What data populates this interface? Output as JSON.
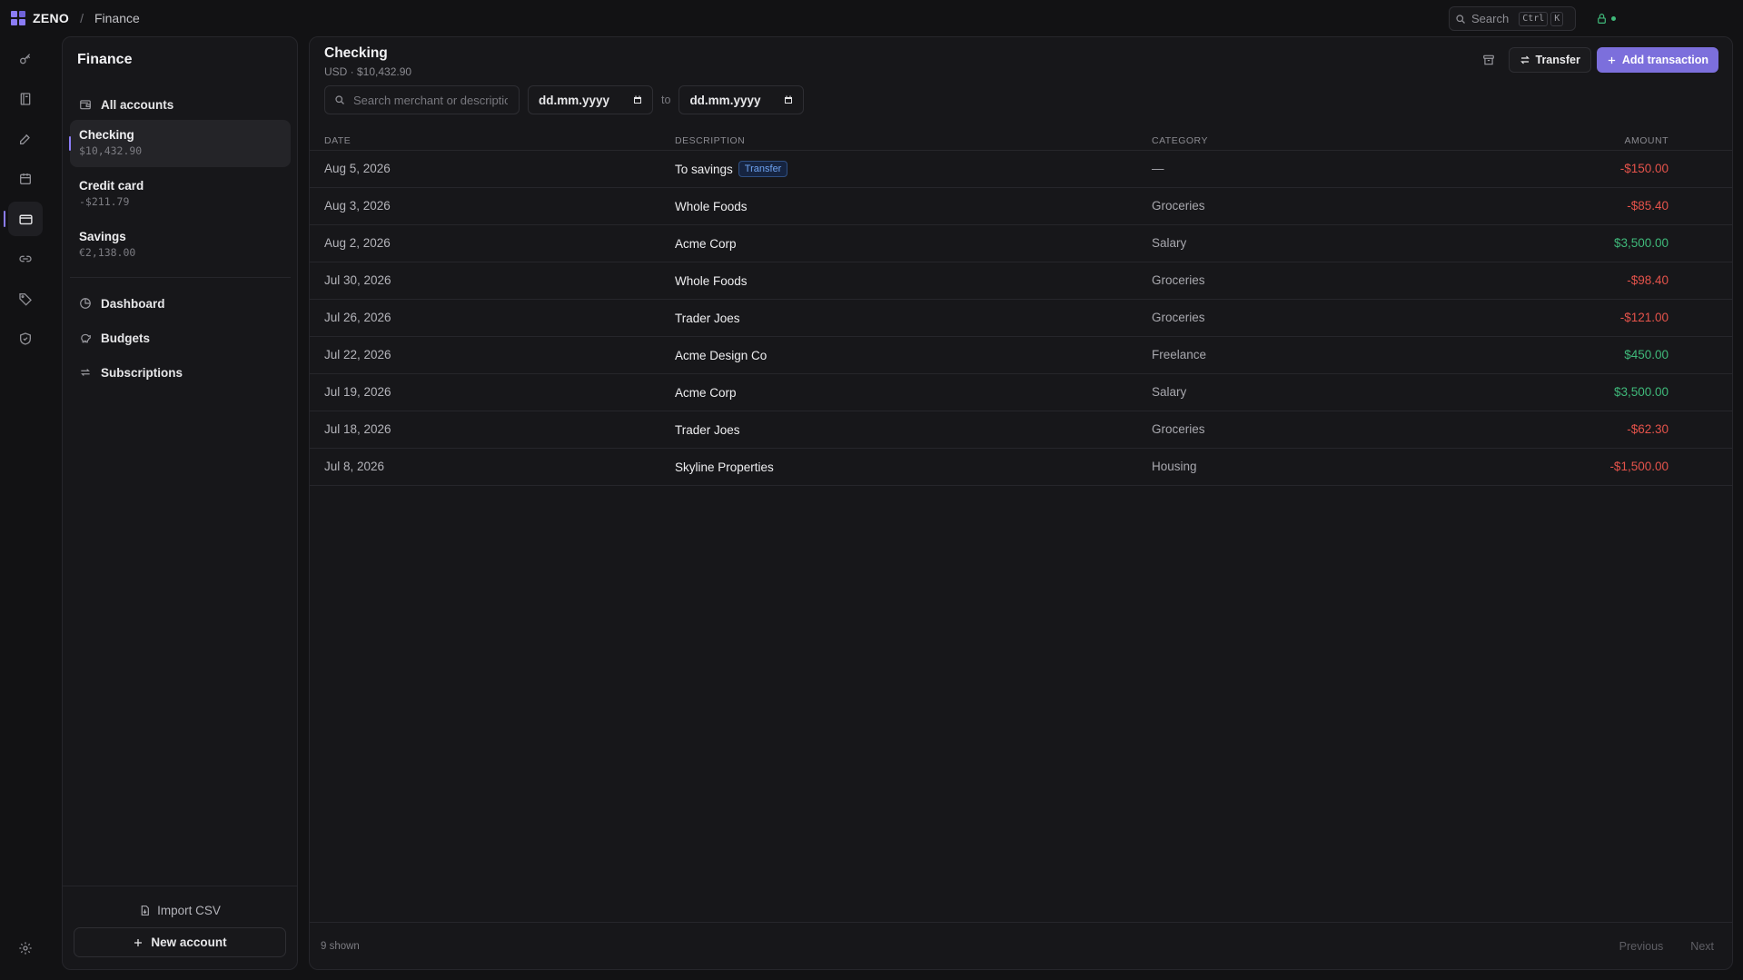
{
  "topbar": {
    "brand": "ZENO",
    "separator": "/",
    "crumb": "Finance",
    "search_label": "Search",
    "kbd_1": "Ctrl",
    "kbd_2": "K"
  },
  "rail": {
    "icons": [
      "key-icon",
      "book-icon",
      "edit-icon",
      "calendar-icon",
      "credit-card-icon",
      "link-icon",
      "tag-icon",
      "shield-icon",
      "gear-icon"
    ],
    "active": "credit-card-icon"
  },
  "sidebar": {
    "title": "Finance",
    "all_accounts": "All accounts",
    "accounts": [
      {
        "name": "Checking",
        "balance": "$10,432.90"
      },
      {
        "name": "Credit card",
        "balance": "-$211.79"
      },
      {
        "name": "Savings",
        "balance": "€2,138.00"
      }
    ],
    "nav": [
      {
        "label": "Dashboard",
        "icon": "pie-chart-icon"
      },
      {
        "label": "Budgets",
        "icon": "piggy-bank-icon"
      },
      {
        "label": "Subscriptions",
        "icon": "repeat-icon"
      }
    ],
    "import_label": "Import CSV",
    "new_account_label": "New account"
  },
  "main": {
    "account_title": "Checking",
    "account_subtitle": "USD · $10,432.90",
    "transfer_label": "Transfer",
    "add_label": "Add transaction",
    "search_placeholder": "Search merchant or description",
    "date_from": "dd.mm.yyyy",
    "date_to": "dd.mm.yyyy",
    "to_label": "to",
    "columns": {
      "date": "DATE",
      "description": "DESCRIPTION",
      "category": "CATEGORY",
      "amount": "AMOUNT"
    },
    "rows": [
      {
        "date": "Aug 5, 2026",
        "description": "To savings",
        "tag": "Transfer",
        "category": "—",
        "amount": "-$150.00",
        "sign": "neg"
      },
      {
        "date": "Aug 3, 2026",
        "description": "Whole Foods",
        "tag": "",
        "category": "Groceries",
        "amount": "-$85.40",
        "sign": "neg"
      },
      {
        "date": "Aug 2, 2026",
        "description": "Acme Corp",
        "tag": "",
        "category": "Salary",
        "amount": "$3,500.00",
        "sign": "pos"
      },
      {
        "date": "Jul 30, 2026",
        "description": "Whole Foods",
        "tag": "",
        "category": "Groceries",
        "amount": "-$98.40",
        "sign": "neg"
      },
      {
        "date": "Jul 26, 2026",
        "description": "Trader Joes",
        "tag": "",
        "category": "Groceries",
        "amount": "-$121.00",
        "sign": "neg"
      },
      {
        "date": "Jul 22, 2026",
        "description": "Acme Design Co",
        "tag": "",
        "category": "Freelance",
        "amount": "$450.00",
        "sign": "pos"
      },
      {
        "date": "Jul 19, 2026",
        "description": "Acme Corp",
        "tag": "",
        "category": "Salary",
        "amount": "$3,500.00",
        "sign": "pos"
      },
      {
        "date": "Jul 18, 2026",
        "description": "Trader Joes",
        "tag": "",
        "category": "Groceries",
        "amount": "-$62.30",
        "sign": "neg"
      },
      {
        "date": "Jul 8, 2026",
        "description": "Skyline Properties",
        "tag": "",
        "category": "Housing",
        "amount": "-$1,500.00",
        "sign": "neg"
      }
    ],
    "shown_count": "9 shown",
    "prev_label": "Previous",
    "next_label": "Next"
  },
  "colors": {
    "accent": "#7c6fdc",
    "negative": "#e5534b",
    "positive": "#3fb97a",
    "tag": "#6fa3f0"
  }
}
